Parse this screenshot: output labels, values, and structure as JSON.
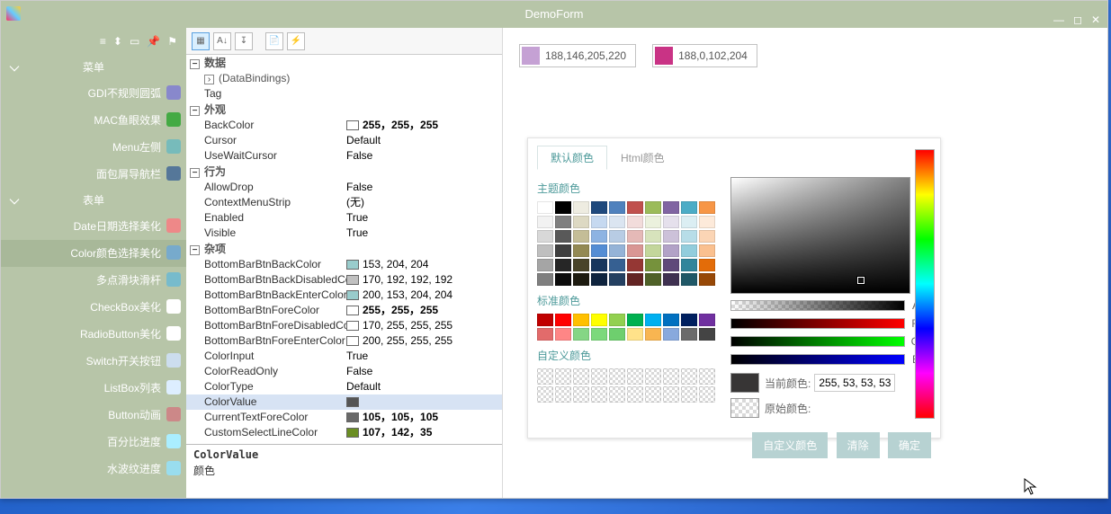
{
  "window": {
    "title": "DemoForm"
  },
  "sidebar": {
    "groups": [
      {
        "title": "菜单",
        "items": [
          {
            "label": "GDI不规则圆弧",
            "icon": "#88c",
            "active": false
          },
          {
            "label": "MAC鱼眼效果",
            "icon": "#4a4",
            "active": false
          },
          {
            "label": "Menu左侧",
            "icon": "#7bb",
            "active": false
          },
          {
            "label": "面包屑导航栏",
            "icon": "#579",
            "active": false
          }
        ]
      },
      {
        "title": "表单",
        "items": [
          {
            "label": "Date日期选择美化",
            "icon": "#e88",
            "active": false
          },
          {
            "label": "Color颜色选择美化",
            "icon": "#7ac",
            "active": true
          },
          {
            "label": "多点滑块滑杆",
            "icon": "#7bc",
            "active": false
          },
          {
            "label": "CheckBox美化",
            "icon": "#fff",
            "active": false
          },
          {
            "label": "RadioButton美化",
            "icon": "#fff",
            "active": false
          },
          {
            "label": "Switch开关按钮",
            "icon": "#cde",
            "active": false
          },
          {
            "label": "ListBox列表",
            "icon": "#def",
            "active": false
          },
          {
            "label": "Button动画",
            "icon": "#c88",
            "active": false
          },
          {
            "label": "百分比进度",
            "icon": "#aef",
            "active": false
          },
          {
            "label": "水波纹进度",
            "icon": "#9de",
            "active": false
          }
        ]
      }
    ]
  },
  "propgrid": {
    "desc": {
      "name": "ColorValue",
      "text": "颜色"
    },
    "cats": [
      {
        "title": "数据",
        "rows": [
          {
            "n": "(DataBindings)",
            "v": "",
            "sub": true
          },
          {
            "n": "Tag",
            "v": ""
          }
        ]
      },
      {
        "title": "外观",
        "rows": [
          {
            "n": "BackColor",
            "v": "255，255，255",
            "swatch": "#ffffff",
            "bold": true
          },
          {
            "n": "Cursor",
            "v": "Default"
          },
          {
            "n": "UseWaitCursor",
            "v": "False"
          }
        ]
      },
      {
        "title": "行为",
        "rows": [
          {
            "n": "AllowDrop",
            "v": "False"
          },
          {
            "n": "ContextMenuStrip",
            "v": "(无)"
          },
          {
            "n": "Enabled",
            "v": "True"
          },
          {
            "n": "Visible",
            "v": "True"
          }
        ]
      },
      {
        "title": "杂项",
        "rows": [
          {
            "n": "BottomBarBtnBackColor",
            "v": "153, 204, 204",
            "swatch": "#99cccc"
          },
          {
            "n": "BottomBarBtnBackDisabledColor",
            "v": "170, 192, 192, 192",
            "swatch": "#c0c0c0"
          },
          {
            "n": "BottomBarBtnBackEnterColor",
            "v": "200, 153, 204, 204",
            "swatch": "#99cccc"
          },
          {
            "n": "BottomBarBtnForeColor",
            "v": "255，255，255",
            "swatch": "#ffffff",
            "bold": true
          },
          {
            "n": "BottomBarBtnForeDisabledColor",
            "v": "170, 255, 255, 255",
            "swatch": "#ffffff"
          },
          {
            "n": "BottomBarBtnForeEnterColor",
            "v": "200, 255, 255, 255",
            "swatch": "#ffffff"
          },
          {
            "n": "ColorInput",
            "v": "True"
          },
          {
            "n": "ColorReadOnly",
            "v": "False"
          },
          {
            "n": "ColorType",
            "v": "Default"
          },
          {
            "n": "ColorValue",
            "v": "",
            "swatch": "#555555",
            "selected": true
          },
          {
            "n": "CurrentTextForeColor",
            "v": "105，105，105",
            "swatch": "#696969",
            "bold": true
          },
          {
            "n": "CustomSelectLineColor",
            "v": "107，142，35",
            "swatch": "#6b8e23",
            "bold": true
          }
        ]
      }
    ]
  },
  "swatches": [
    {
      "color": "rgba(188,146,205,0.86)",
      "text": "188,146,205,220"
    },
    {
      "color": "rgba(188,0,102,0.8)",
      "text": "188,0,102,204"
    }
  ],
  "picker": {
    "tabs": [
      {
        "label": "默认颜色",
        "active": true
      },
      {
        "label": "Html颜色",
        "active": false
      }
    ],
    "sections": {
      "theme": "主题颜色",
      "standard": "标准颜色",
      "custom": "自定义颜色"
    },
    "theme_colors": [
      [
        "#ffffff",
        "#000000",
        "#eeece1",
        "#1f497d",
        "#4f81bd",
        "#c0504d",
        "#9bbb59",
        "#8064a2",
        "#4bacc6",
        "#f79646"
      ],
      [
        "#f2f2f2",
        "#7f7f7f",
        "#ddd9c3",
        "#c6d9f0",
        "#dbe5f1",
        "#f2dcdb",
        "#ebf1dd",
        "#e5e0ec",
        "#dbeef3",
        "#fdeada"
      ],
      [
        "#d8d8d8",
        "#595959",
        "#c4bd97",
        "#8db3e2",
        "#b8cce4",
        "#e5b9b7",
        "#d7e3bc",
        "#ccc1d9",
        "#b7dde8",
        "#fbd5b5"
      ],
      [
        "#bfbfbf",
        "#3f3f3f",
        "#938953",
        "#548dd4",
        "#95b3d7",
        "#d99694",
        "#c3d69b",
        "#b2a2c7",
        "#92cddc",
        "#fac08f"
      ],
      [
        "#a5a5a5",
        "#262626",
        "#494429",
        "#17365d",
        "#366092",
        "#953734",
        "#76923c",
        "#5f497a",
        "#31859b",
        "#e36c09"
      ],
      [
        "#7f7f7f",
        "#0c0c0c",
        "#1d1b10",
        "#0f243e",
        "#244061",
        "#632423",
        "#4f6128",
        "#3f3151",
        "#205867",
        "#974806"
      ]
    ],
    "standard_colors": [
      [
        "#c00000",
        "#ff0000",
        "#ffc000",
        "#ffff00",
        "#92d050",
        "#00b050",
        "#00b0f0",
        "#0070c0",
        "#002060",
        "#7030a0"
      ],
      [
        "#e26b6b",
        "#fe8686",
        "#85d685",
        "#7cd97c",
        "#6ecf6e",
        "#ffe28a",
        "#f8b551",
        "#88a9dd",
        "#6b6b6b",
        "#444444"
      ]
    ],
    "sliders": {
      "a": "A",
      "r": "R",
      "g": "G",
      "b": "B"
    },
    "labels": {
      "current": "当前颜色:",
      "origin": "原始颜色:"
    },
    "current_value": "255, 53, 53, 53",
    "buttons": {
      "custom": "自定义颜色",
      "clear": "清除",
      "ok": "确定"
    }
  }
}
